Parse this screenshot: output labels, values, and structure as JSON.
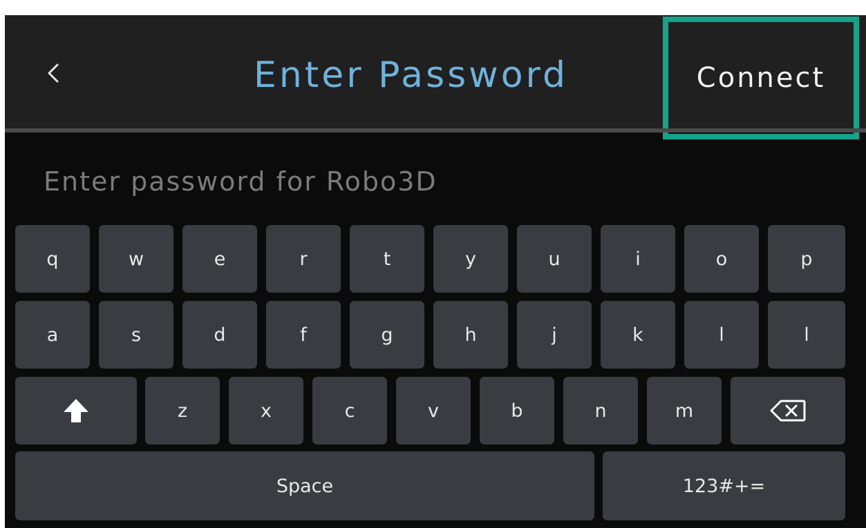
{
  "header": {
    "back_icon": "chevron-left-icon",
    "title": "Enter Password",
    "connect_label": "Connect",
    "highlight_color": "#16a38a",
    "title_color": "#6fb2dc"
  },
  "password_field": {
    "placeholder": "Enter password for Robo3D"
  },
  "keyboard": {
    "row1": [
      "q",
      "w",
      "e",
      "r",
      "t",
      "y",
      "u",
      "i",
      "o",
      "p"
    ],
    "row2": [
      "a",
      "s",
      "d",
      "f",
      "g",
      "h",
      "j",
      "k",
      "l",
      "l"
    ],
    "row3": [
      "z",
      "x",
      "c",
      "v",
      "b",
      "n",
      "m"
    ],
    "shift_icon": "shift-arrow-icon",
    "backspace_icon": "backspace-icon",
    "space_label": "Space",
    "symbols_label": "123#+="
  }
}
